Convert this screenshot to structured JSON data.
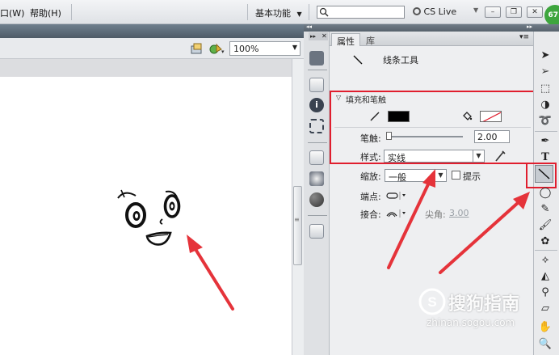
{
  "menubar": {
    "items": [
      "口(W)",
      "帮助(H)"
    ],
    "workspace_label": "基本功能",
    "search_placeholder": "",
    "cs_live_label": "CS Live",
    "badge_value": "67"
  },
  "stage": {
    "zoom_value": "100%"
  },
  "panel": {
    "tabs": [
      "属性",
      "库"
    ],
    "tool_name": "线条工具",
    "section_title": "填充和笔触",
    "stroke_label": "笔触:",
    "stroke_value": "2.00",
    "style_label": "样式:",
    "style_value": "实线",
    "scale_label": "缩放:",
    "scale_value": "一般",
    "hint_label": "提示",
    "cap_label": "端点:",
    "join_label": "接合:",
    "miter_label": "尖角:",
    "miter_value": "3.00"
  },
  "colors": {
    "stroke_color": "#000000",
    "highlight": "#e01e2e",
    "arrow": "#e5333a"
  },
  "watermark": {
    "text": "搜狗指南",
    "url": "zhinan.sogou.com"
  }
}
